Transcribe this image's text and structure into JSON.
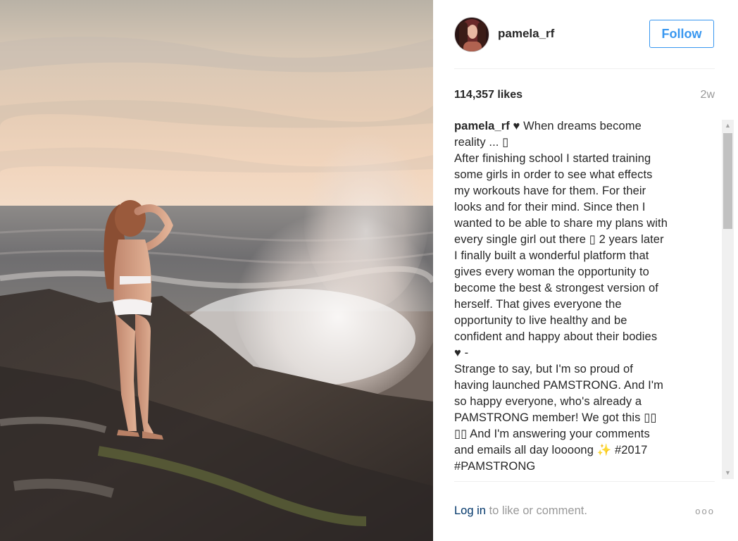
{
  "post": {
    "username": "pamela_rf",
    "follow_label": "Follow",
    "likes": "114,357 likes",
    "age": "2w",
    "caption_user": "pamela_rf",
    "caption_text": " ♥ When dreams become\nreality ... ▯\nAfter finishing school I started training\nsome girls in order to see what effects\nmy workouts have for them. For their\nlooks and for their mind. Since then I\nwanted to be able to share my plans with\nevery single girl out there ▯ 2 years later\nI finally built a wonderful platform that\ngives every woman the opportunity to\nbecome the best & strongest version of\nherself. That gives everyone the\nopportunity to live healthy and be\nconfident and happy about their bodies\n♥ -\nStrange to say, but I'm so proud of\nhaving launched PAMSTRONG. And I'm\nso happy everyone, who's already a\nPAMSTRONG member! We got this ▯▯\n▯▯ And I'm answering your comments\nand emails all day loooong ✨ #2017\n#PAMSTRONG"
  },
  "footer": {
    "login_link": "Log in",
    "login_rest": " to like or comment.",
    "more": "ooo"
  },
  "scrollbar": {
    "up_arrow": "▲",
    "down_arrow": "▼"
  },
  "colors": {
    "accent": "#3897f0",
    "link": "#003569",
    "muted": "#999999"
  }
}
